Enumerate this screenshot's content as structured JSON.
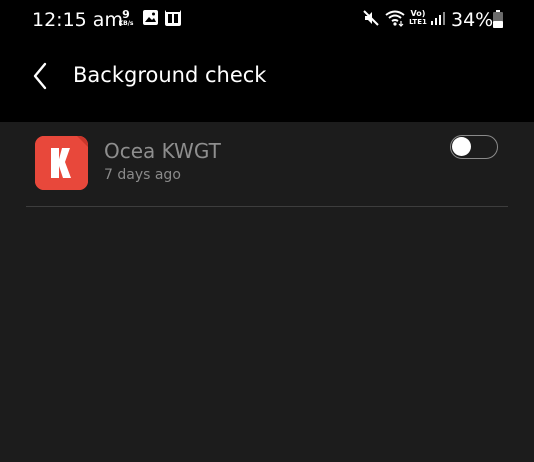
{
  "status_bar": {
    "time": "12:15 am",
    "net_speed_value": "9",
    "net_speed_unit": "KB/s",
    "battery_percent": "34%",
    "icons": [
      "gallery-icon",
      "phone-storage-icon",
      "mute-icon",
      "wifi-icon",
      "volte-lte-icon",
      "signal-icon",
      "battery-icon"
    ],
    "volte_label": "Vo)",
    "lte_label": "LTE1"
  },
  "app_bar": {
    "back_icon": "chevron-left-icon",
    "title": "Background check"
  },
  "apps": [
    {
      "name": "Ocea KWGT",
      "meta": "7 days ago",
      "icon": "kwgt-app-icon",
      "icon_color": "#e8483b",
      "toggle_on": false
    }
  ],
  "colors": {
    "background": "#000000",
    "content_background": "#1c1c1c",
    "text_primary": "#ffffff",
    "text_secondary": "#8e8e8e",
    "divider": "#3d3d3d"
  }
}
